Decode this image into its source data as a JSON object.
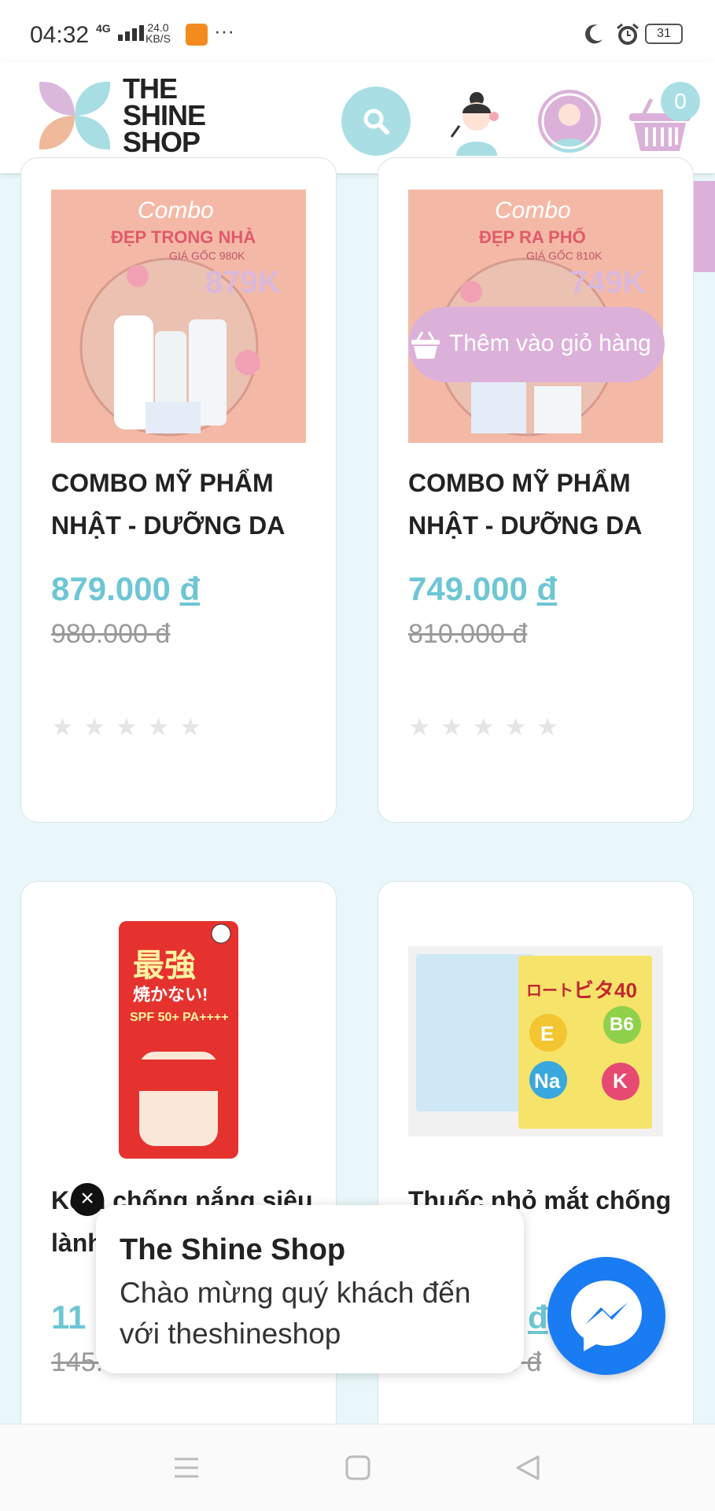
{
  "status_bar": {
    "time": "04:32",
    "network": "4G",
    "speed": "24.0",
    "speed_unit": "KB/S",
    "dots": "···",
    "battery": "31"
  },
  "header": {
    "logo_lines": [
      "THE",
      "SHINE",
      "SHOP"
    ],
    "cart_count": "0",
    "icons": [
      "search-icon",
      "beauty-model-icon",
      "user-icon",
      "cart-icon"
    ]
  },
  "products": [
    {
      "name": "COMBO MỸ PHẨM NHẬT - DƯỠNG DA",
      "price": "879.000",
      "old_price": "980.000",
      "currency": "đ",
      "image": {
        "combo_word": "Combo",
        "headline": "ĐẸP TRONG NHÀ",
        "orig_label": "GIÁ GỐC 980K",
        "sale": "879K"
      }
    },
    {
      "name": "COMBO MỸ PHẨM NHẬT - DƯỠNG DA",
      "price": "749.000",
      "old_price": "810.000",
      "currency": "đ",
      "image": {
        "combo_word": "Combo",
        "headline": "ĐẸP RA PHỐ",
        "orig_label": "GIÁ GỐC 810K",
        "sale": "749K"
      }
    },
    {
      "name": "Kem chống nắng siêu lành",
      "price": "11",
      "old_price": "145.",
      "currency": "đ",
      "image": {
        "label1": "最強",
        "label2": "焼かない!",
        "label3": "SPF 50+ PA++++"
      }
    },
    {
      "name": "Thuốc nhỏ mắt chống cận thị",
      "price": "",
      "old_price": "0",
      "currency": "đ",
      "image": {
        "label1": "ロート",
        "label2": "ビタ40",
        "vitamins": [
          "E",
          "B6",
          "Na",
          "K"
        ]
      }
    }
  ],
  "add_to_cart_label": "Thêm vào giỏ hàng",
  "chat_popup": {
    "title": "The Shine Shop",
    "message": "Chào mừng quý khách đến với theshineshop",
    "close": "×"
  },
  "colors": {
    "accent_teal": "#6ec6d4",
    "accent_pink": "#dcb1d9",
    "messenger": "#1a7cf2",
    "background": "#e9f7fa"
  }
}
